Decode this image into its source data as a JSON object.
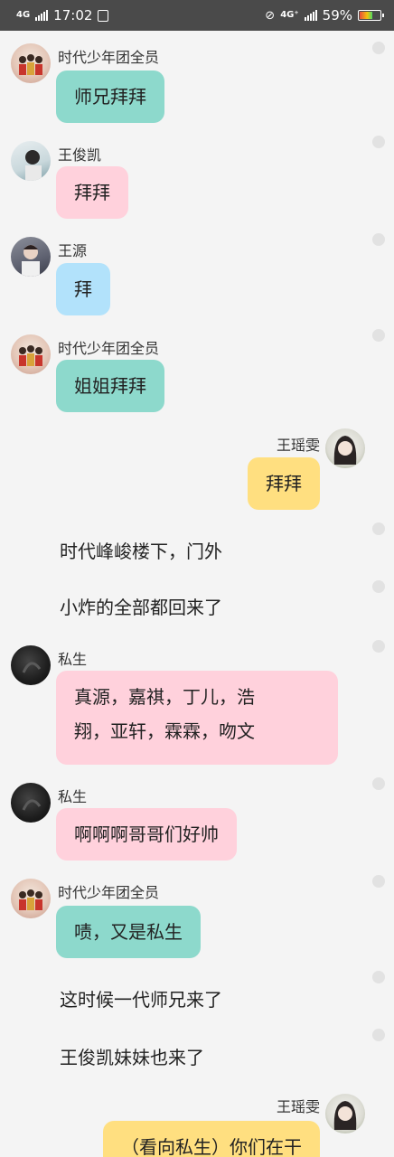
{
  "status_bar": {
    "network": "4G",
    "time": "17:02",
    "network2": "4G⁺",
    "battery": "59%",
    "battery_level": 0.59
  },
  "messages": [
    {
      "type": "left",
      "name": "时代少年团全员",
      "text": "师兄拜拜",
      "color": "#8dd9cc"
    },
    {
      "type": "left",
      "name": "王俊凯",
      "text": "拜拜",
      "color": "#ffd1dc"
    },
    {
      "type": "left",
      "name": "王源",
      "text": "拜",
      "color": "#b2e2fb"
    },
    {
      "type": "left",
      "name": "时代少年团全员",
      "text": "姐姐拜拜",
      "color": "#8dd9cc"
    },
    {
      "type": "right",
      "name": "王瑶雯",
      "text": "拜拜",
      "color": "#ffdf80"
    },
    {
      "type": "narration",
      "text": "时代峰峻楼下，门外"
    },
    {
      "type": "narration",
      "text": "小炸的全部都回来了"
    },
    {
      "type": "left",
      "name": "私生",
      "text_lines": [
        "真源，嘉祺，丁儿，浩",
        "翔，亚轩，霖霖，吻文"
      ],
      "color": "#ffd1dc"
    },
    {
      "type": "left",
      "name": "私生",
      "text": "啊啊啊哥哥们好帅",
      "color": "#ffd1dc"
    },
    {
      "type": "left",
      "name": "时代少年团全员",
      "text": "啧，又是私生",
      "color": "#8dd9cc"
    },
    {
      "type": "narration",
      "text": "这时候一代师兄来了"
    },
    {
      "type": "narration",
      "text": "王俊凯妹妹也来了"
    },
    {
      "type": "right",
      "name": "王瑶雯",
      "text": "（看向私生）你们在干",
      "color": "#ffdf80"
    }
  ]
}
